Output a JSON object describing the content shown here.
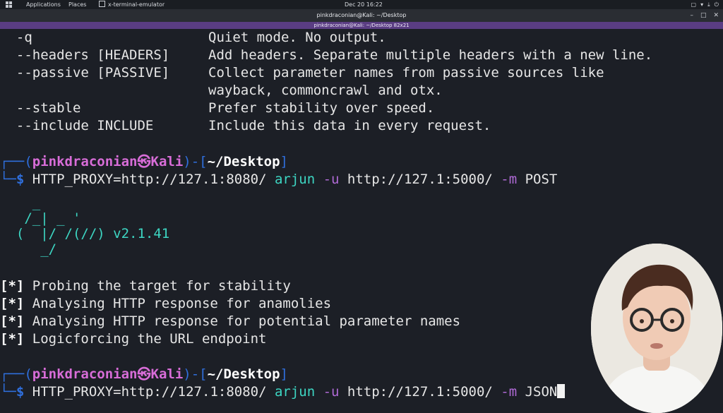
{
  "panel": {
    "applications": "Applications",
    "places": "Places",
    "task": "x-terminal-emulator",
    "clock": "Dec 20  16:22",
    "tray": [
      "▢",
      "▾",
      "⤓",
      "⏻"
    ]
  },
  "window": {
    "title": "pinkdraconian@Kali: ~/Desktop",
    "subtitle": "pinkdraconian@Kali: ~/Desktop 82x21",
    "buttons": [
      "–",
      "□",
      "✕"
    ]
  },
  "terminal": {
    "help": [
      {
        "flag": "  -q",
        "desc": "Quiet mode. No output."
      },
      {
        "flag": "  --headers [HEADERS]",
        "desc": "Add headers. Separate multiple headers with a new line."
      },
      {
        "flag": "  --passive [PASSIVE]",
        "desc": "Collect parameter names from passive sources like"
      },
      {
        "flag": "",
        "desc": "wayback, commoncrawl and otx."
      },
      {
        "flag": "  --stable",
        "desc": "Prefer stability over speed."
      },
      {
        "flag": "  --include INCLUDE",
        "desc": "Include this data in every request."
      }
    ],
    "prompt": {
      "corner_top": "┌──(",
      "user": "pinkdraconian",
      "skull": "㉿",
      "host": "Kali",
      "mid": ")-[",
      "path": "~/Desktop",
      "end": "]",
      "corner_bottom": "└─",
      "dollar": "$"
    },
    "cmd1": {
      "env": " HTTP_PROXY=http://127.1:8080/ ",
      "bin": "arjun",
      "f1": " -u",
      "url": " http://127.1:5000/ ",
      "f2": "-m",
      "val": " POST"
    },
    "banner": [
      "    _",
      "   /_| _ '",
      "  (  |/ /(//) v2.1.41",
      "     _/"
    ],
    "status": [
      {
        "mark": "[*]",
        "text": " Probing the target for stability"
      },
      {
        "mark": "[*]",
        "text": " Analysing HTTP response for anamolies"
      },
      {
        "mark": "[*]",
        "text": " Analysing HTTP response for potential parameter names"
      },
      {
        "mark": "[*]",
        "text": " Logicforcing the URL endpoint"
      }
    ],
    "cmd2": {
      "env": " HTTP_PROXY=http://127.1:8080/ ",
      "bin": "arjun",
      "f1": " -u",
      "url": " http://127.1:5000/ ",
      "f2": "-m",
      "val": " JSON"
    }
  },
  "colors": {
    "prompt_frame": "#2f6fdd",
    "user": "#d86dd8",
    "path": "#ffffff",
    "banner": "#3dd6c3",
    "subbar": "#5a3d83"
  }
}
